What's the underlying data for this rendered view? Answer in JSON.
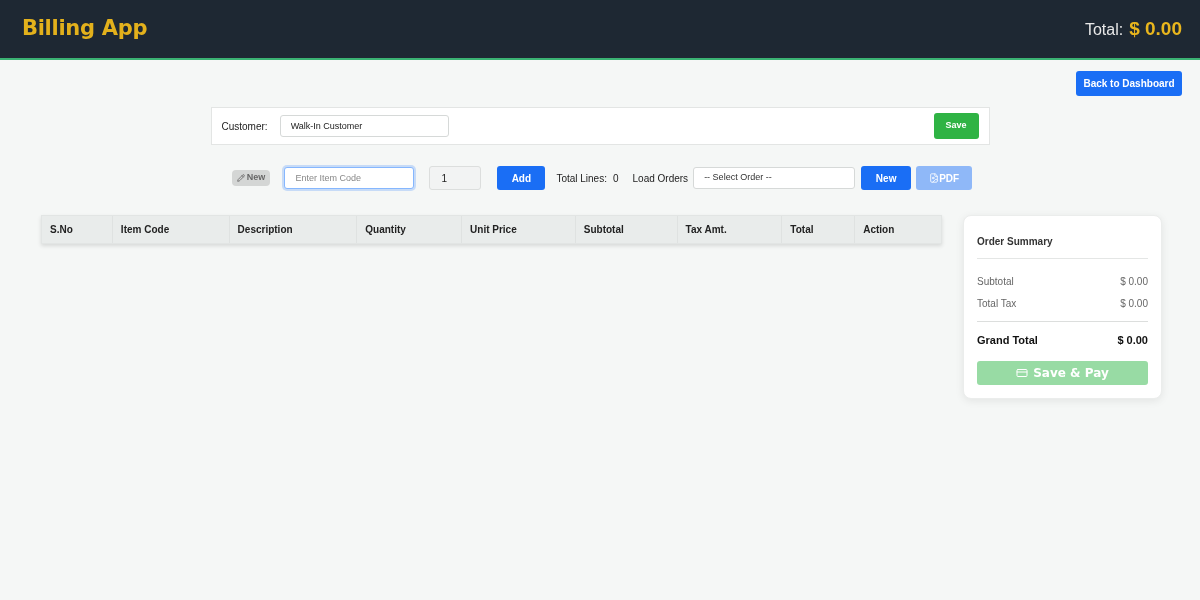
{
  "header": {
    "title": "Billing App",
    "total_label": "Total:",
    "total_value": "$ 0.00"
  },
  "back_button": "Back to Dashboard",
  "customer": {
    "label": "Customer:",
    "value": "Walk-In Customer",
    "save_button": "Save"
  },
  "toolbar": {
    "new_badge": "New",
    "item_code": {
      "placeholder": "Enter Item Code",
      "focused": true
    },
    "quantity": "1",
    "add_button": "Add",
    "total_lines_label": "Total Lines:",
    "total_lines": "0",
    "load_orders_label": "Load Orders",
    "order_select": "-- Select Order --",
    "new_button": "New",
    "pdf_button": {
      "label": "PDF",
      "disabled": true
    }
  },
  "table": {
    "columns": [
      "S.No",
      "Item Code",
      "Description",
      "Quantity",
      "Unit Price",
      "Subtotal",
      "Tax Amt.",
      "Total",
      "Action"
    ]
  },
  "summary": {
    "title": "Order Summary",
    "rows": [
      {
        "label": "Subtotal",
        "value": "$ 0.00"
      },
      {
        "label": "Total Tax",
        "value": "$ 0.00"
      }
    ],
    "grand_total": {
      "label": "Grand Total",
      "value": "$ 0.00"
    },
    "pay_button": {
      "label": "Save & Pay",
      "disabled": true
    }
  }
}
